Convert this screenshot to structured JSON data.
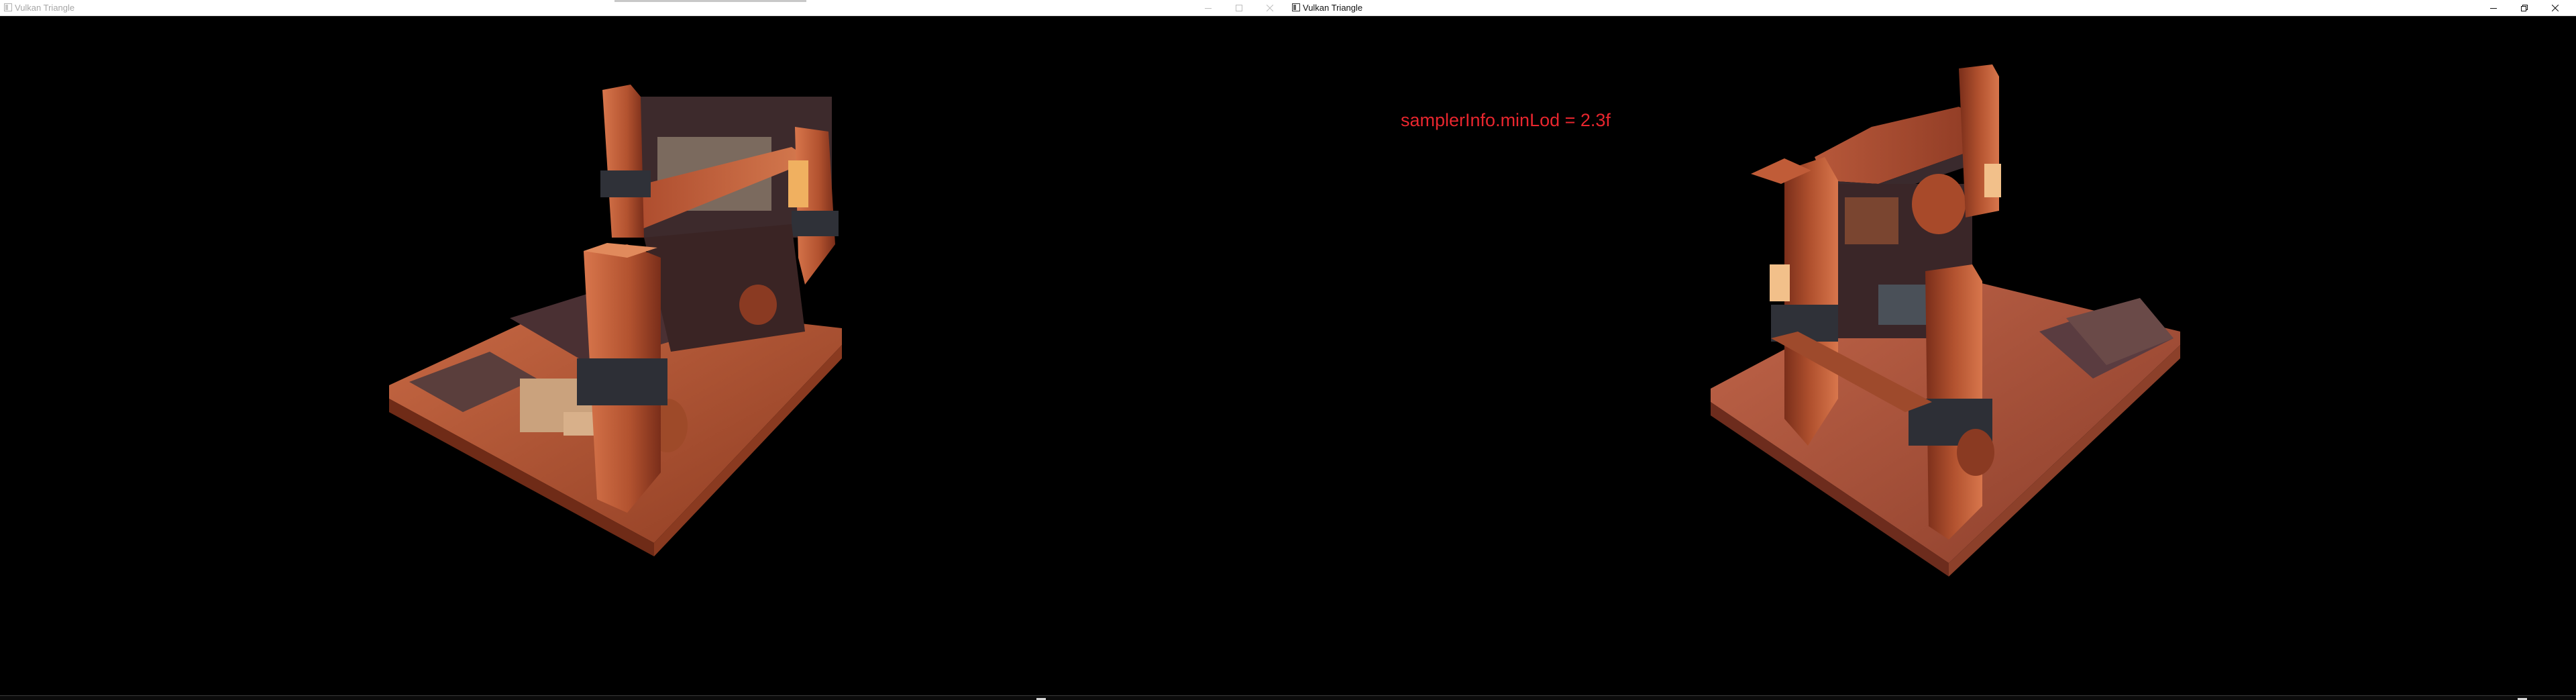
{
  "windows": {
    "left": {
      "title": "Vulkan Triangle",
      "state": "inactive",
      "controls": [
        "minimize",
        "maximize",
        "close"
      ],
      "icon": "window-app-icon"
    },
    "right": {
      "title": "Vulkan Triangle",
      "state": "active",
      "controls": [
        "minimize",
        "restore",
        "close"
      ],
      "icon": "window-app-icon",
      "overlay_text": "samplerInfo.minLod = 2.3f",
      "overlay_color": "#e8262e"
    }
  },
  "scene": {
    "description_icon": "isometric-tavern-model",
    "palette": {
      "wood_light": "#d9744a",
      "wood_mid": "#b6502f",
      "wood_dark": "#6a2818",
      "stone": "#4a3033",
      "metal": "#3c3f46",
      "background": "#000000"
    }
  }
}
